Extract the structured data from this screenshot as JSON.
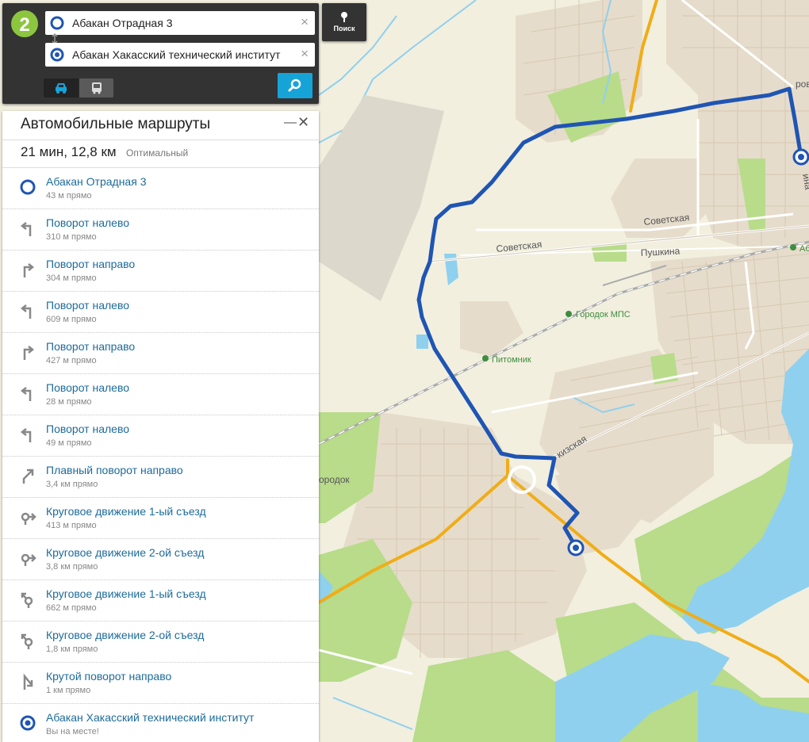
{
  "search": {
    "from_value": "Абакан Отрадная 3",
    "to_value": "Абакан Хакасский технический институт",
    "clear_glyph": "×",
    "search_button_label": "Поиск"
  },
  "directions": {
    "title": "Автомобильные маршруты",
    "minimize_glyph": "—",
    "close_glyph": "✕",
    "summary_duration": "21 мин, 12,8 км",
    "summary_tag": "Оптимальный",
    "steps": [
      {
        "title": "Абакан Отрадная 3",
        "distance": "43 м прямо",
        "icon": "start-point-icon"
      },
      {
        "title": "Поворот налево",
        "distance": "310 м прямо",
        "icon": "turn-left-icon"
      },
      {
        "title": "Поворот направо",
        "distance": "304 м прямо",
        "icon": "turn-right-icon"
      },
      {
        "title": "Поворот налево",
        "distance": "609 м прямо",
        "icon": "turn-left-icon"
      },
      {
        "title": "Поворот направо",
        "distance": "427 м прямо",
        "icon": "turn-right-icon"
      },
      {
        "title": "Поворот налево",
        "distance": "28 м прямо",
        "icon": "turn-left-icon"
      },
      {
        "title": "Поворот налево",
        "distance": "49 м прямо",
        "icon": "turn-left-icon"
      },
      {
        "title": "Плавный поворот направо",
        "distance": "3,4 км прямо",
        "icon": "slight-right-icon"
      },
      {
        "title": "Круговое движение 1-ый съезд",
        "distance": "413 м прямо",
        "icon": "roundabout-icon"
      },
      {
        "title": "Круговое движение 2-ой съезд",
        "distance": "3,8 км прямо",
        "icon": "roundabout-icon"
      },
      {
        "title": "Круговое движение 1-ый съезд",
        "distance": "662 м прямо",
        "icon": "roundabout-left-icon"
      },
      {
        "title": "Круговое движение 2-ой съезд",
        "distance": "1,8 км прямо",
        "icon": "roundabout-left-icon"
      },
      {
        "title": "Крутой поворот направо",
        "distance": "1 км прямо",
        "icon": "sharp-right-icon"
      },
      {
        "title": "Абакан Хакасский технический институт",
        "distance": "Вы на месте!",
        "icon": "end-point-icon"
      }
    ]
  },
  "map": {
    "street_labels": {
      "sovetskaya_1": "Советская",
      "sovetskaya_2": "Советская",
      "pushkina": "Пушкина",
      "kizskaya": "кизская",
      "gorodok_left": "ородок",
      "orova": "рова",
      "ina": "ина",
      "ab": "Аб"
    },
    "poi_labels": {
      "gorodok_mps": "Городок МПС",
      "pitomnik": "Питомник"
    },
    "colors": {
      "route": "#1f55b3",
      "highway": "#f0ad18",
      "water": "#8fd0ee",
      "greenery": "#b8dc8a",
      "land": "#f2efdf",
      "urban": "#e6dccb"
    }
  },
  "theme": {
    "panel_bg": "#333333",
    "accent": "#16a4d8",
    "link_color": "#1d6b9b",
    "logo_color": "#8cc63f"
  }
}
